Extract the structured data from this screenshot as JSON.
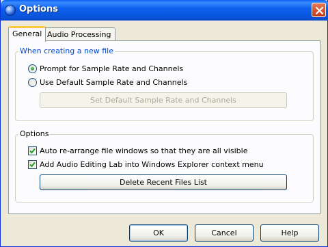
{
  "window": {
    "title": "Options",
    "close_icon": "close-icon",
    "title_icon": "app-orb-icon"
  },
  "tabs": [
    {
      "label": "General",
      "selected": true
    },
    {
      "label": "Audio Processing",
      "selected": false
    }
  ],
  "group_new_file": {
    "legend": "When creating a new file",
    "options": [
      {
        "label": "Prompt for Sample Rate and Channels",
        "selected": true
      },
      {
        "label": "Use Default Sample Rate and Channels",
        "selected": false
      }
    ],
    "set_default_button": "Set Default Sample Rate and Channels",
    "set_default_enabled": false
  },
  "group_options": {
    "legend": "Options",
    "checks": [
      {
        "label": "Auto re-arrange file windows so that they are all visible",
        "checked": true
      },
      {
        "label": "Add Audio Editing Lab into Windows Explorer context menu",
        "checked": true
      }
    ],
    "delete_button": "Delete Recent Files List"
  },
  "footer": {
    "ok": "OK",
    "cancel": "Cancel",
    "help": "Help"
  },
  "colors": {
    "titlebar": "#0a54dc",
    "legend_accent": "#0046d5",
    "tab_highlight": "#ffc83c",
    "close_button": "#d4512d"
  }
}
